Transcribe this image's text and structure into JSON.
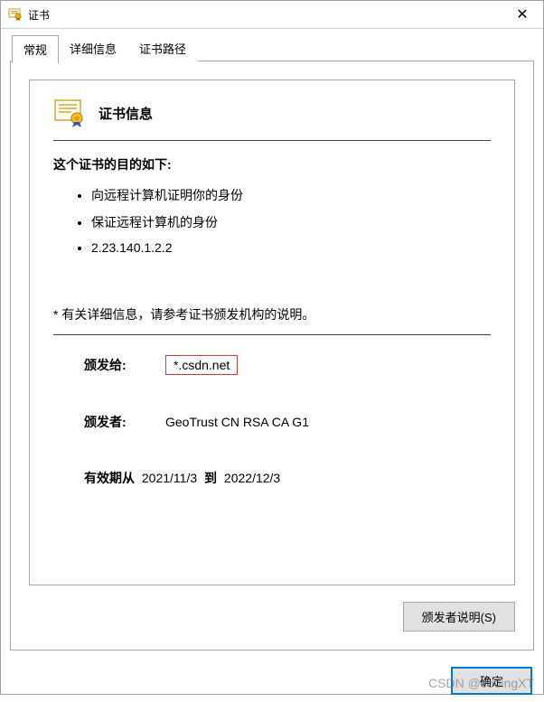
{
  "window": {
    "title": "证书"
  },
  "tabs": [
    {
      "label": "常规",
      "active": true
    },
    {
      "label": "详细信息",
      "active": false
    },
    {
      "label": "证书路径",
      "active": false
    }
  ],
  "cert": {
    "info_title": "证书信息",
    "purpose_title": "这个证书的目的如下:",
    "purposes": [
      "向远程计算机证明你的身份",
      "保证远程计算机的身份",
      "2.23.140.1.2.2"
    ],
    "details_note": "* 有关详细信息，请参考证书颁发机构的说明。",
    "issued_to_label": "颁发给:",
    "issued_to_value": "*.csdn.net",
    "issued_by_label": "颁发者:",
    "issued_by_value": "GeoTrust CN RSA CA G1",
    "valid_from_label": "有效期从",
    "valid_from_value": "2021/11/3",
    "valid_to_label": "到",
    "valid_to_value": "2022/12/3"
  },
  "buttons": {
    "issuer_statement": "颁发者说明(S)",
    "ok": "确定"
  },
  "watermark": "CSDN @codingXT"
}
